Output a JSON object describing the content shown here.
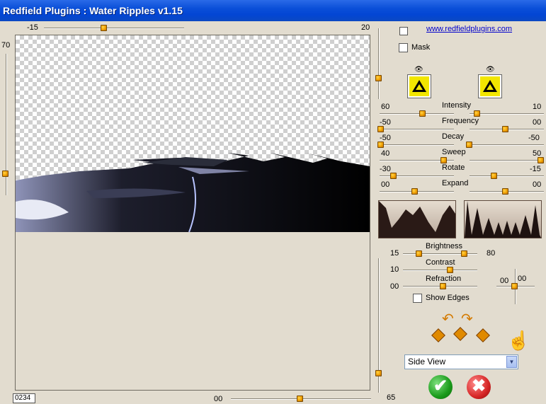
{
  "window": {
    "title": "Redfield Plugins : Water Ripples v1.15"
  },
  "top_slider": {
    "min_label": "-15",
    "max_label": "20"
  },
  "left_slider": {
    "value_label": "70"
  },
  "bottom_slider": {
    "value_label": "00"
  },
  "right_vertical_slider": {
    "value_label": "65"
  },
  "status": {
    "frame": "0234"
  },
  "link": {
    "text": "www.redfieldplugins.com"
  },
  "mask": {
    "label": "Mask",
    "checked": false
  },
  "params": {
    "intensity": {
      "label": "Intensity",
      "left": "60",
      "right": "10"
    },
    "frequency": {
      "label": "Frequency",
      "left": "-50",
      "right": "00"
    },
    "decay": {
      "label": "Decay",
      "left": "-50",
      "right": "-50"
    },
    "sweep": {
      "label": "Sweep",
      "left": "40",
      "right": "50"
    },
    "rotate": {
      "label": "Rotate",
      "left": "-30",
      "right": "-15"
    },
    "expand": {
      "label": "Expand",
      "left": "00",
      "right": "00"
    }
  },
  "brightness": {
    "label": "Brightness",
    "left": "15",
    "right": "80"
  },
  "contrast": {
    "label": "Contrast",
    "value": "10"
  },
  "refraction": {
    "label": "Refraction",
    "value": "00"
  },
  "offset": {
    "x": "00",
    "y": "00"
  },
  "show_edges": {
    "label": "Show Edges",
    "checked": false
  },
  "view_select": {
    "value": "Side View"
  },
  "buttons": {
    "ok": "✔",
    "cancel": "✖"
  },
  "icons": [
    "eye-icon",
    "randomize-icon",
    "hand-icon",
    "ok-icon",
    "cancel-icon"
  ],
  "colors": {
    "accent": "#f0a000",
    "title_bar": "#0a4fd8",
    "ok": "#2aa52a",
    "cancel": "#d62626"
  }
}
